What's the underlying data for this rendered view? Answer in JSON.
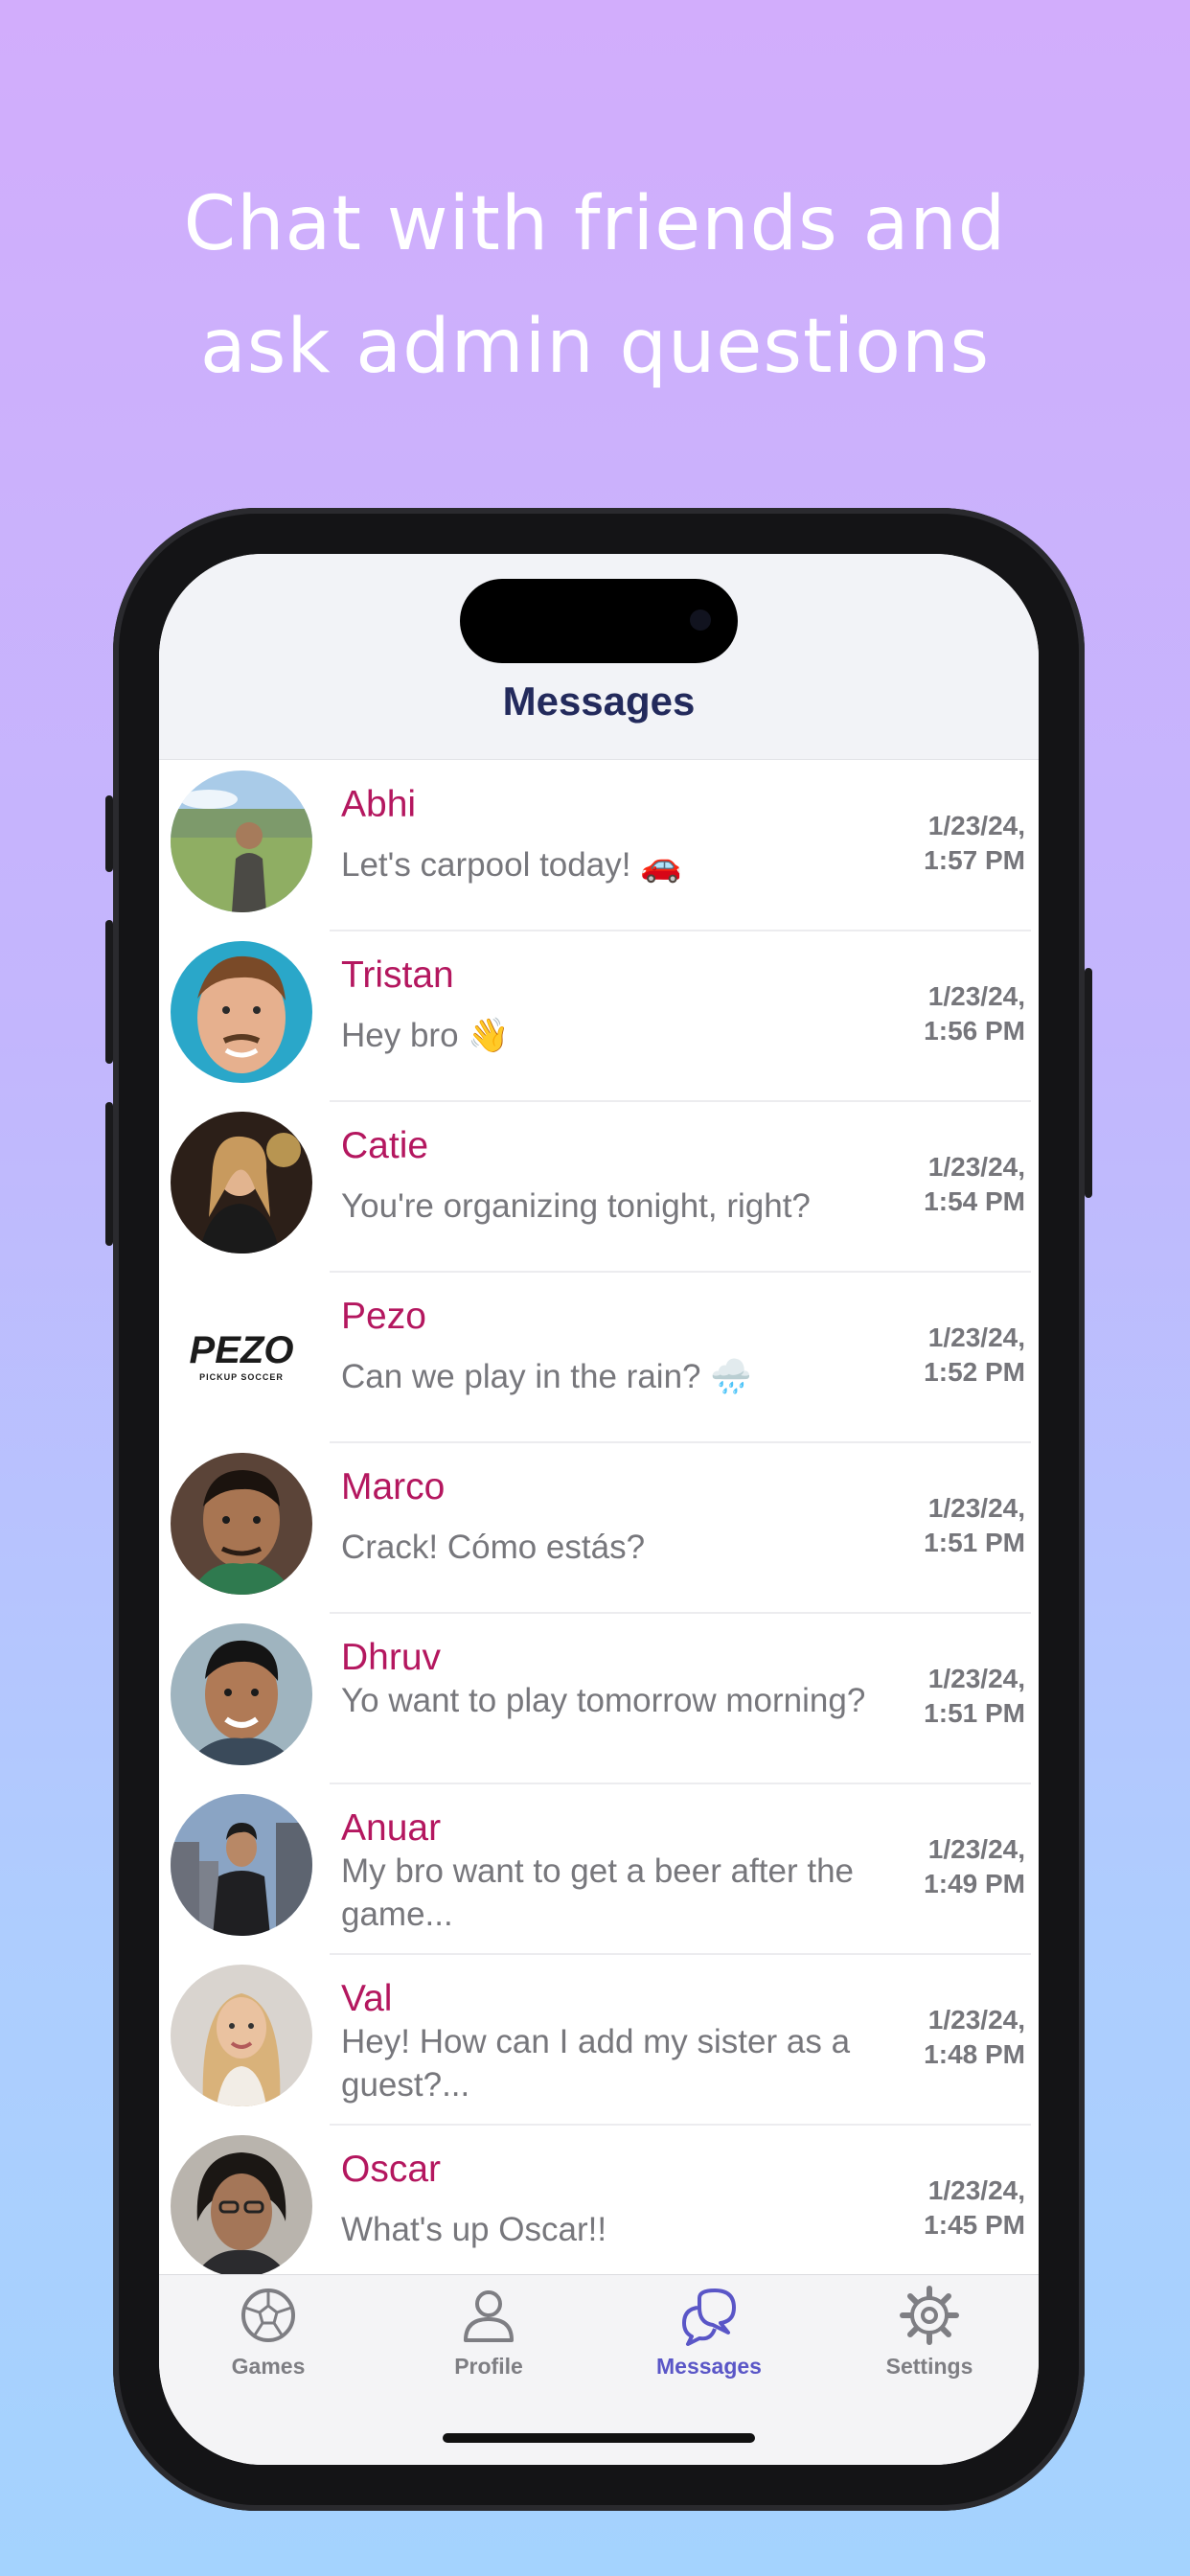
{
  "headline": {
    "line1": "Chat with friends and",
    "line2": "ask admin questions"
  },
  "screen_title": "Messages",
  "conversations": [
    {
      "name": "Abhi",
      "preview": "Let's carpool today! 🚗",
      "date": "1/23/24,",
      "time": "1:57 PM",
      "avatar": "photo-avatar"
    },
    {
      "name": "Tristan",
      "preview": "Hey bro 👋",
      "date": "1/23/24,",
      "time": "1:56 PM",
      "avatar": "photo-avatar"
    },
    {
      "name": "Catie",
      "preview": "You're organizing tonight, right?",
      "date": "1/23/24,",
      "time": "1:54 PM",
      "avatar": "photo-avatar"
    },
    {
      "name": "Pezo",
      "preview": "Can we play in the rain? 🌧️",
      "date": "1/23/24,",
      "time": "1:52 PM",
      "avatar": "pezo-logo",
      "logo_text": "PEZO",
      "logo_sub": "PICKUP SOCCER"
    },
    {
      "name": "Marco",
      "preview": "Crack! Cómo estás?",
      "date": "1/23/24,",
      "time": "1:51 PM",
      "avatar": "photo-avatar"
    },
    {
      "name": "Dhruv",
      "preview": "Yo want to play tomorrow morning?",
      "date": "1/23/24,",
      "time": "1:51 PM",
      "avatar": "photo-avatar"
    },
    {
      "name": "Anuar",
      "preview": "My bro want to get a beer after the game...",
      "date": "1/23/24,",
      "time": "1:49 PM",
      "avatar": "photo-avatar"
    },
    {
      "name": "Val",
      "preview": "Hey! How can I add my sister as a guest?...",
      "date": "1/23/24,",
      "time": "1:48 PM",
      "avatar": "photo-avatar"
    },
    {
      "name": "Oscar",
      "preview": "What's up Oscar!!",
      "date": "1/23/24,",
      "time": "1:45 PM",
      "avatar": "photo-avatar"
    }
  ],
  "tabs": [
    {
      "label": "Games",
      "icon": "soccer-ball-icon"
    },
    {
      "label": "Profile",
      "icon": "person-icon"
    },
    {
      "label": "Messages",
      "icon": "chat-bubbles-icon",
      "active": true
    },
    {
      "label": "Settings",
      "icon": "gear-icon"
    }
  ],
  "colors": {
    "name": "#b4175f",
    "title": "#232a5c",
    "active_tab": "#5a56c7",
    "inactive_tab": "#7e7e83",
    "background_top": "#d2adfc",
    "background_bottom": "#a4d3fe"
  }
}
